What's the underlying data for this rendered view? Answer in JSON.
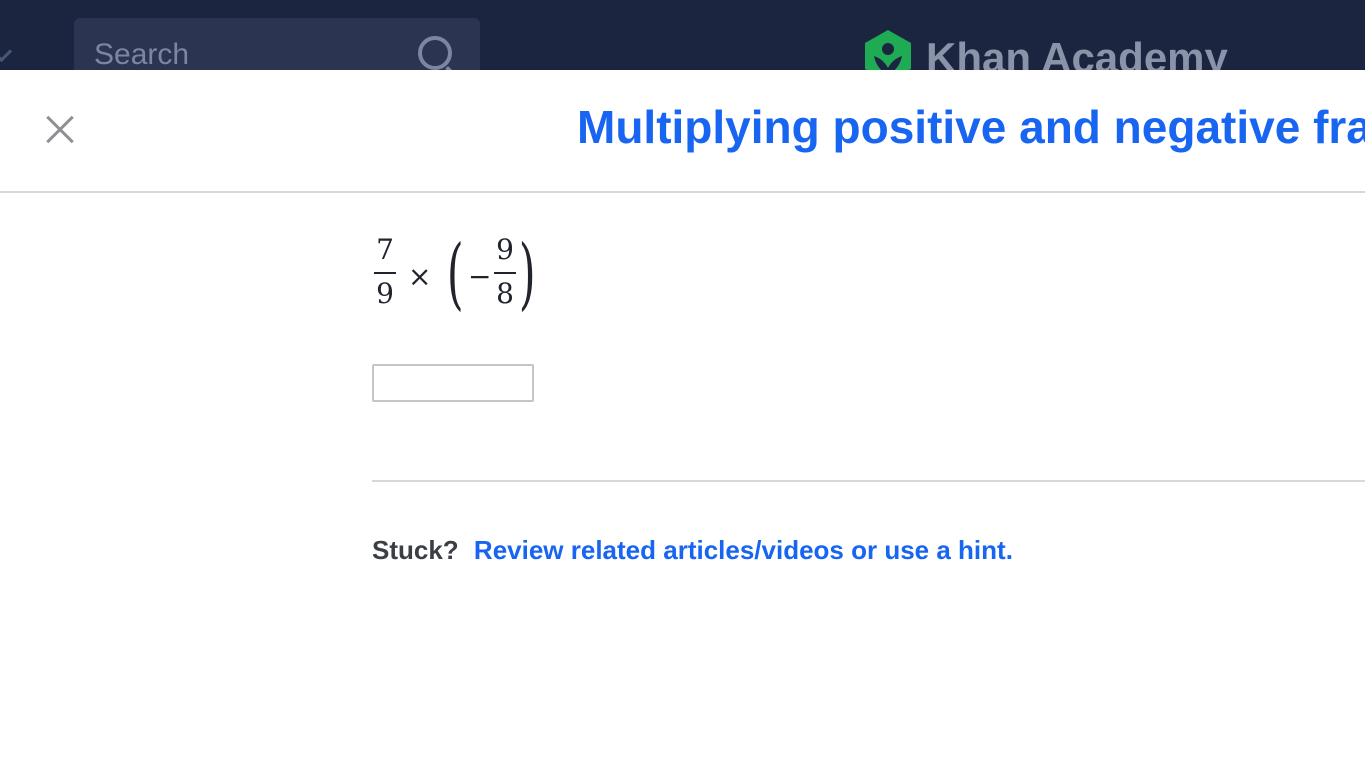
{
  "topbar": {
    "search_placeholder": "Search",
    "brand_name": "Khan Academy",
    "logo_color": "#1fab54"
  },
  "modal": {
    "title": "Multiplying positive and negative fractions",
    "close_icon": "close-icon"
  },
  "problem": {
    "term1": {
      "numerator": "7",
      "denominator": "9"
    },
    "operator": "×",
    "open_paren": "(",
    "sign": "−",
    "term2": {
      "numerator": "9",
      "denominator": "8"
    },
    "close_paren": ")",
    "answer_value": ""
  },
  "help": {
    "stuck_label": "Stuck?",
    "hint_link": "Review related articles/videos or use a hint."
  },
  "colors": {
    "accent": "#1865f2",
    "topbar_bg": "#1b2540",
    "divider": "#d6d8da"
  }
}
